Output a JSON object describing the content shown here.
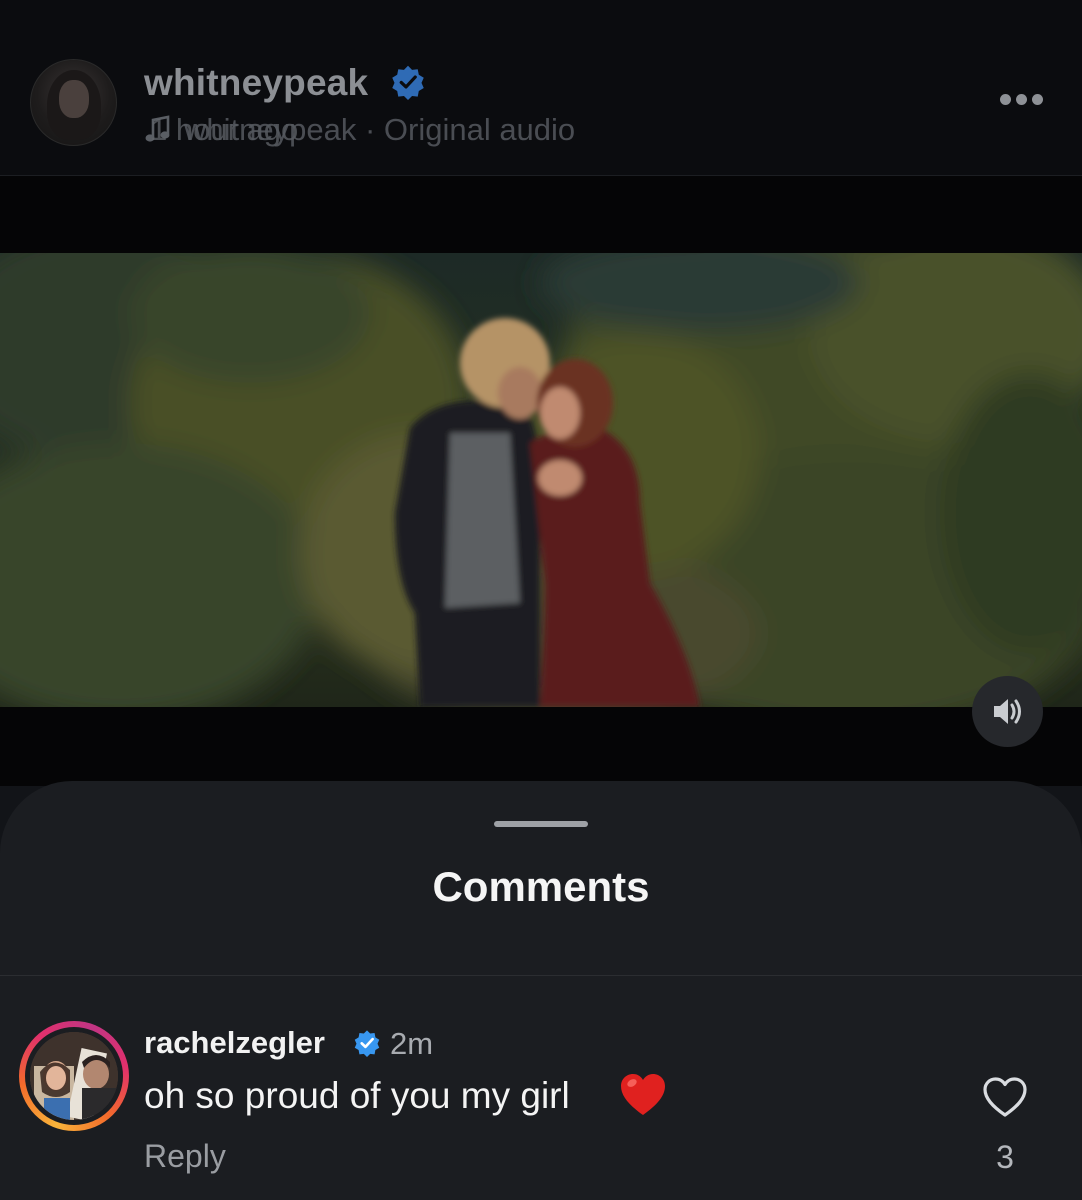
{
  "post": {
    "username": "whitneypeak",
    "time_ago": "1 hour ago",
    "audio_label": "whitneypeak · Original audio",
    "verified": true
  },
  "icons": {
    "verified": "verified-badge-icon",
    "more": "more-dots-icon",
    "music": "music-note-icon",
    "volume": "speaker-volume-icon",
    "like": "heart-outline-icon",
    "emoji": "red-heart-emoji"
  },
  "comments_sheet": {
    "title": "Comments",
    "comments": [
      {
        "username": "rachelzegler",
        "verified": true,
        "time": "2m",
        "text": "oh so proud of you my girl",
        "reply_label": "Reply",
        "like_count": "3"
      }
    ]
  },
  "colors": {
    "verified_blue": "#3897f0",
    "heart_red": "#e0211f",
    "story_ring": [
      "#f9b43a",
      "#e1306c",
      "#c13584"
    ]
  }
}
